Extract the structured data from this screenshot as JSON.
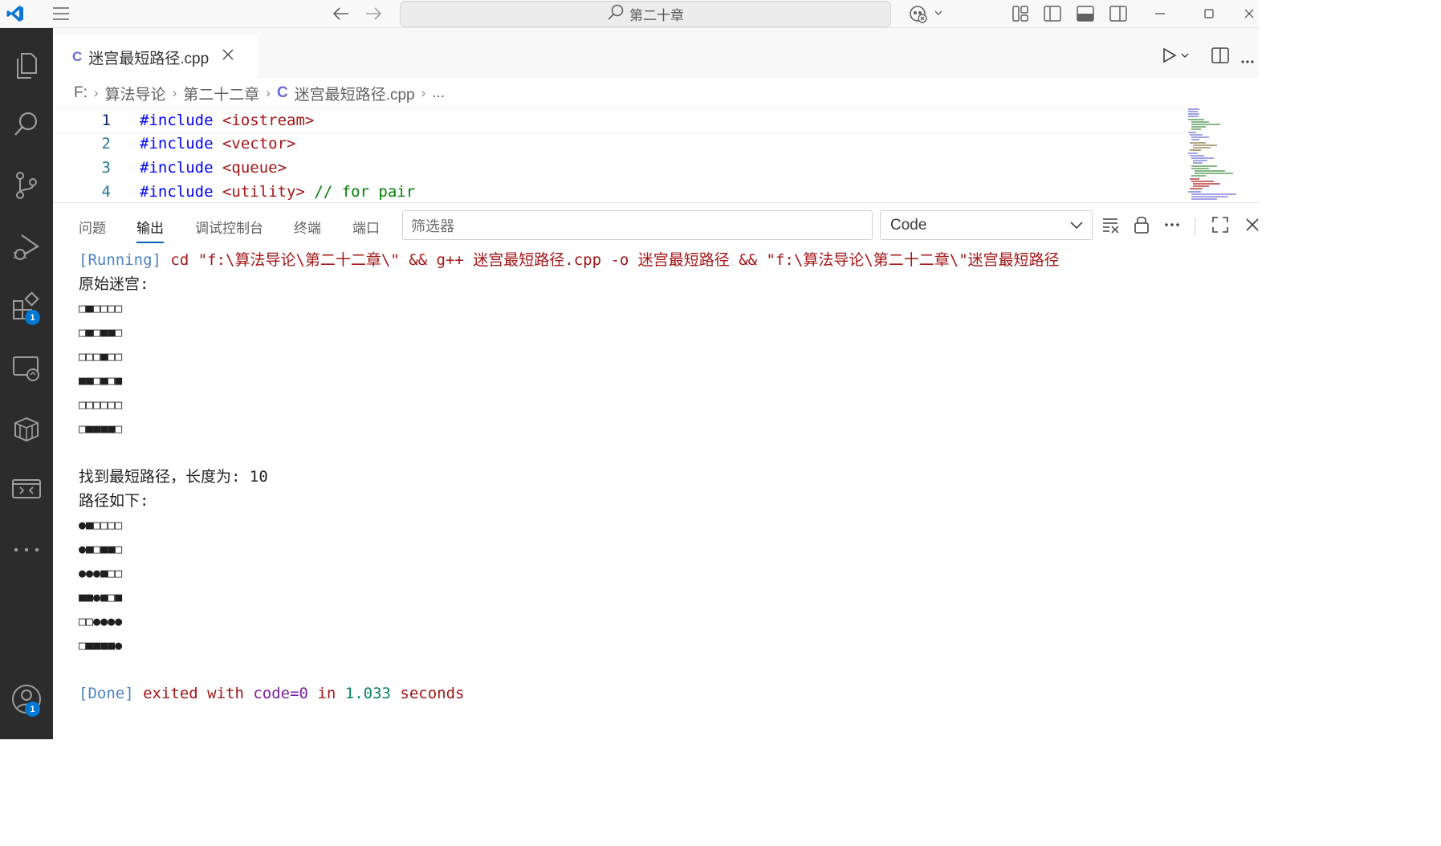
{
  "titlebar": {
    "search_text": "第二十章"
  },
  "activity_bar": {
    "extensions_badge": "1",
    "accounts_badge": "1"
  },
  "tab": {
    "filename": "迷宫最短路径.cpp"
  },
  "breadcrumb": {
    "drive": "F:",
    "folder1": "算法导论",
    "folder2": "第二十二章",
    "file": "迷宫最短路径.cpp",
    "more": "..."
  },
  "editor": {
    "lines": [
      {
        "num": "1",
        "kw": "#include",
        "arg": " <iostream>",
        "comment": ""
      },
      {
        "num": "2",
        "kw": "#include",
        "arg": " <vector>",
        "comment": ""
      },
      {
        "num": "3",
        "kw": "#include",
        "arg": " <queue>",
        "comment": ""
      },
      {
        "num": "4",
        "kw": "#include",
        "arg": " <utility>",
        "comment": " // for pair"
      }
    ]
  },
  "panel": {
    "tabs": [
      "问题",
      "输出",
      "调试控制台",
      "终端",
      "端口"
    ],
    "active_tab": "输出",
    "filter_placeholder": "筛选器",
    "channel": "Code"
  },
  "output": {
    "run_tag": "[Running]",
    "run_cmd": " cd \"f:\\算法导论\\第二十二章\\\" && g++ 迷宫最短路径.cpp -o 迷宫最短路径 && \"f:\\算法导论\\第二十二章\\\"迷宫最短路径",
    "maze_title": "原始迷宫:",
    "maze_rows": [
      "□■□□□□",
      "□■□■■□",
      "□□□■□□",
      "■■□■□■",
      "□□□□□□",
      "□■■■■□"
    ],
    "found_text": "找到最短路径，长度为: ",
    "found_len": "10",
    "path_title": "路径如下:",
    "path_rows": [
      "●■□□□□",
      "●■□■■□",
      "●●●■□□",
      "■■●■□■",
      "□□●●●●",
      "□■■■■●"
    ],
    "done_tag": "[Done]",
    "done_exited": " exited with ",
    "done_code": "code=0",
    "done_in": " in ",
    "done_time": "1.033",
    "done_seconds": " seconds"
  },
  "colors": {
    "activity_bg": "#2c2c2c",
    "accent": "#0078d4",
    "keyword": "#0000ff",
    "string": "#a31515",
    "comment": "#008000"
  }
}
